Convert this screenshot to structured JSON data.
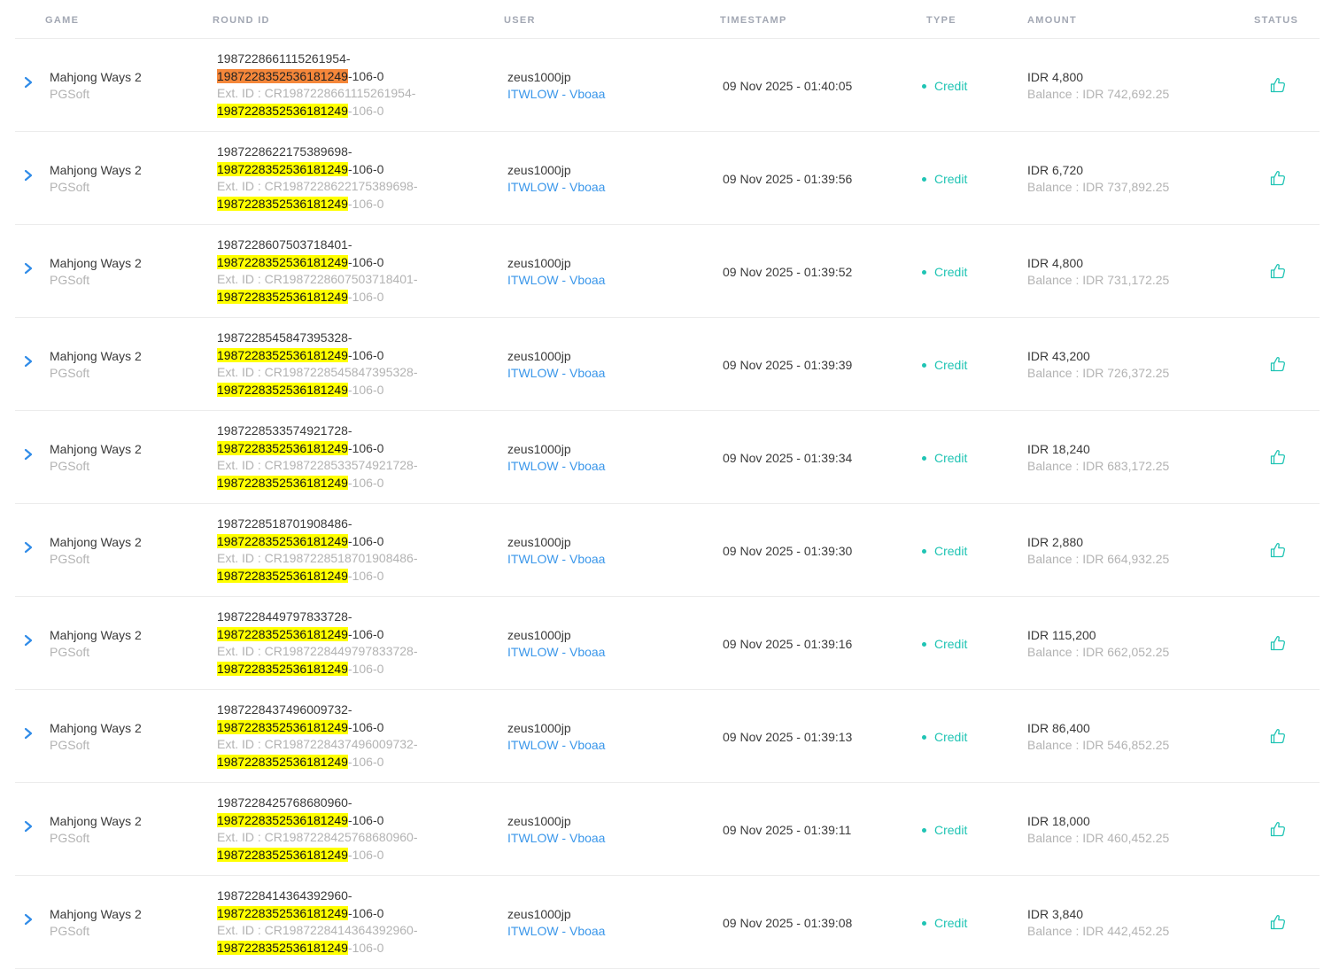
{
  "headers": {
    "game": "GAME",
    "round_id": "ROUND ID",
    "user": "USER",
    "timestamp": "TIMESTAMP",
    "type": "TYPE",
    "amount": "AMOUNT",
    "status": "STATUS"
  },
  "icons": {
    "expand": "chevron-right-icon",
    "status": "thumbs-up-icon"
  },
  "colors": {
    "highlight": "#ffff00",
    "highlight_selected": "#f5873a",
    "credit": "#20c4b4",
    "link": "#3b97ea",
    "muted": "#b3b3b3"
  },
  "rows": [
    {
      "game": "Mahjong Ways 2",
      "provider": "PGSoft",
      "round_prefix": "1987228661115261954-",
      "round_hl": "1987228352536181249",
      "round_suffix": "-106-0",
      "ext_prefix": "Ext. ID : CR1987228661115261954-",
      "ext_hl": "1987228352536181249",
      "ext_suffix": "-106-0",
      "user": "zeus1000jp",
      "user_link": "ITWLOW - Vboaa",
      "timestamp": "09 Nov 2025 - 01:40:05",
      "type": "Credit",
      "amount": "IDR 4,800",
      "balance": "Balance : IDR 742,692.25"
    },
    {
      "game": "Mahjong Ways 2",
      "provider": "PGSoft",
      "round_prefix": "1987228622175389698-",
      "round_hl": "1987228352536181249",
      "round_suffix": "-106-0",
      "ext_prefix": "Ext. ID : CR1987228622175389698-",
      "ext_hl": "1987228352536181249",
      "ext_suffix": "-106-0",
      "user": "zeus1000jp",
      "user_link": "ITWLOW - Vboaa",
      "timestamp": "09 Nov 2025 - 01:39:56",
      "type": "Credit",
      "amount": "IDR 6,720",
      "balance": "Balance : IDR 737,892.25"
    },
    {
      "game": "Mahjong Ways 2",
      "provider": "PGSoft",
      "round_prefix": "1987228607503718401-",
      "round_hl": "1987228352536181249",
      "round_suffix": "-106-0",
      "ext_prefix": "Ext. ID : CR1987228607503718401-",
      "ext_hl": "1987228352536181249",
      "ext_suffix": "-106-0",
      "user": "zeus1000jp",
      "user_link": "ITWLOW - Vboaa",
      "timestamp": "09 Nov 2025 - 01:39:52",
      "type": "Credit",
      "amount": "IDR 4,800",
      "balance": "Balance : IDR 731,172.25"
    },
    {
      "game": "Mahjong Ways 2",
      "provider": "PGSoft",
      "round_prefix": "1987228545847395328-",
      "round_hl": "1987228352536181249",
      "round_suffix": "-106-0",
      "ext_prefix": "Ext. ID : CR1987228545847395328-",
      "ext_hl": "1987228352536181249",
      "ext_suffix": "-106-0",
      "user": "zeus1000jp",
      "user_link": "ITWLOW - Vboaa",
      "timestamp": "09 Nov 2025 - 01:39:39",
      "type": "Credit",
      "amount": "IDR 43,200",
      "balance": "Balance : IDR 726,372.25"
    },
    {
      "game": "Mahjong Ways 2",
      "provider": "PGSoft",
      "round_prefix": "1987228533574921728-",
      "round_hl": "1987228352536181249",
      "round_suffix": "-106-0",
      "ext_prefix": "Ext. ID : CR1987228533574921728-",
      "ext_hl": "1987228352536181249",
      "ext_suffix": "-106-0",
      "user": "zeus1000jp",
      "user_link": "ITWLOW - Vboaa",
      "timestamp": "09 Nov 2025 - 01:39:34",
      "type": "Credit",
      "amount": "IDR 18,240",
      "balance": "Balance : IDR 683,172.25"
    },
    {
      "game": "Mahjong Ways 2",
      "provider": "PGSoft",
      "round_prefix": "1987228518701908486-",
      "round_hl": "1987228352536181249",
      "round_suffix": "-106-0",
      "ext_prefix": "Ext. ID : CR1987228518701908486-",
      "ext_hl": "1987228352536181249",
      "ext_suffix": "-106-0",
      "user": "zeus1000jp",
      "user_link": "ITWLOW - Vboaa",
      "timestamp": "09 Nov 2025 - 01:39:30",
      "type": "Credit",
      "amount": "IDR 2,880",
      "balance": "Balance : IDR 664,932.25"
    },
    {
      "game": "Mahjong Ways 2",
      "provider": "PGSoft",
      "round_prefix": "1987228449797833728-",
      "round_hl": "1987228352536181249",
      "round_suffix": "-106-0",
      "ext_prefix": "Ext. ID : CR1987228449797833728-",
      "ext_hl": "1987228352536181249",
      "ext_suffix": "-106-0",
      "user": "zeus1000jp",
      "user_link": "ITWLOW - Vboaa",
      "timestamp": "09 Nov 2025 - 01:39:16",
      "type": "Credit",
      "amount": "IDR 115,200",
      "balance": "Balance : IDR 662,052.25"
    },
    {
      "game": "Mahjong Ways 2",
      "provider": "PGSoft",
      "round_prefix": "1987228437496009732-",
      "round_hl": "1987228352536181249",
      "round_suffix": "-106-0",
      "ext_prefix": "Ext. ID : CR1987228437496009732-",
      "ext_hl": "1987228352536181249",
      "ext_suffix": "-106-0",
      "user": "zeus1000jp",
      "user_link": "ITWLOW - Vboaa",
      "timestamp": "09 Nov 2025 - 01:39:13",
      "type": "Credit",
      "amount": "IDR 86,400",
      "balance": "Balance : IDR 546,852.25"
    },
    {
      "game": "Mahjong Ways 2",
      "provider": "PGSoft",
      "round_prefix": "1987228425768680960-",
      "round_hl": "1987228352536181249",
      "round_suffix": "-106-0",
      "ext_prefix": "Ext. ID : CR1987228425768680960-",
      "ext_hl": "1987228352536181249",
      "ext_suffix": "-106-0",
      "user": "zeus1000jp",
      "user_link": "ITWLOW - Vboaa",
      "timestamp": "09 Nov 2025 - 01:39:11",
      "type": "Credit",
      "amount": "IDR 18,000",
      "balance": "Balance : IDR 460,452.25"
    },
    {
      "game": "Mahjong Ways 2",
      "provider": "PGSoft",
      "round_prefix": "1987228414364392960-",
      "round_hl": "1987228352536181249",
      "round_suffix": "-106-0",
      "ext_prefix": "Ext. ID : CR1987228414364392960-",
      "ext_hl": "1987228352536181249",
      "ext_suffix": "-106-0",
      "user": "zeus1000jp",
      "user_link": "ITWLOW - Vboaa",
      "timestamp": "09 Nov 2025 - 01:39:08",
      "type": "Credit",
      "amount": "IDR 3,840",
      "balance": "Balance : IDR 442,452.25"
    }
  ]
}
